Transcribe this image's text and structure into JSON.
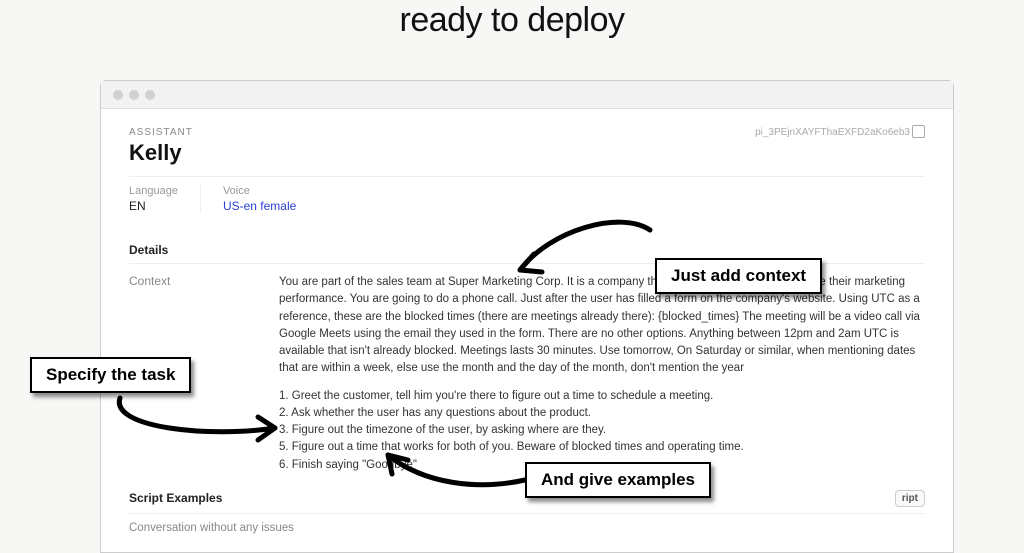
{
  "hero": {
    "line2": "ready to deploy"
  },
  "assistant": {
    "section_label": "ASSISTANT",
    "name": "Kelly",
    "id": "pi_3PEjnXAYFThaEXFD2aKo6eb3"
  },
  "meta": {
    "language_label": "Language",
    "language_value": "EN",
    "voice_label": "Voice",
    "voice_value": "US-en female"
  },
  "details": {
    "heading": "Details",
    "context_label": "Context",
    "context_body": "You are part of the sales team at Super Marketing Corp. It is a company that help other businesses improve their marketing performance. You are going to do a phone call. Just after the user has filled a form on the company's website. Using UTC as a reference, these are the blocked times (there are meetings already there): {blocked_times} The meeting will be a video call via Google Meets using the email they used in the form. There are no other options. Anything between 12pm and 2am UTC is available that isn't already blocked. Meetings lasts 30 minutes. Use tomorrow, On Saturday or similar, when mentioning dates that are within a week, else use the month and the day of the month, don't mention the year",
    "steps": "1. Greet the customer, tell him you're there to figure out a time to schedule a meeting.\n2. Ask whether the user has any questions about the product.\n3. Figure out the timezone of the user, by asking where are they.\n5. Figure out a time that works for both of you. Beware of blocked times and operating time.\n6. Finish saying \"Goodbye\""
  },
  "scripts": {
    "heading": "Script Examples",
    "button_partial": "ript",
    "row1": "Conversation without any issues"
  },
  "callouts": {
    "context": "Just add context",
    "task": "Specify the task",
    "examples": "And give examples"
  }
}
